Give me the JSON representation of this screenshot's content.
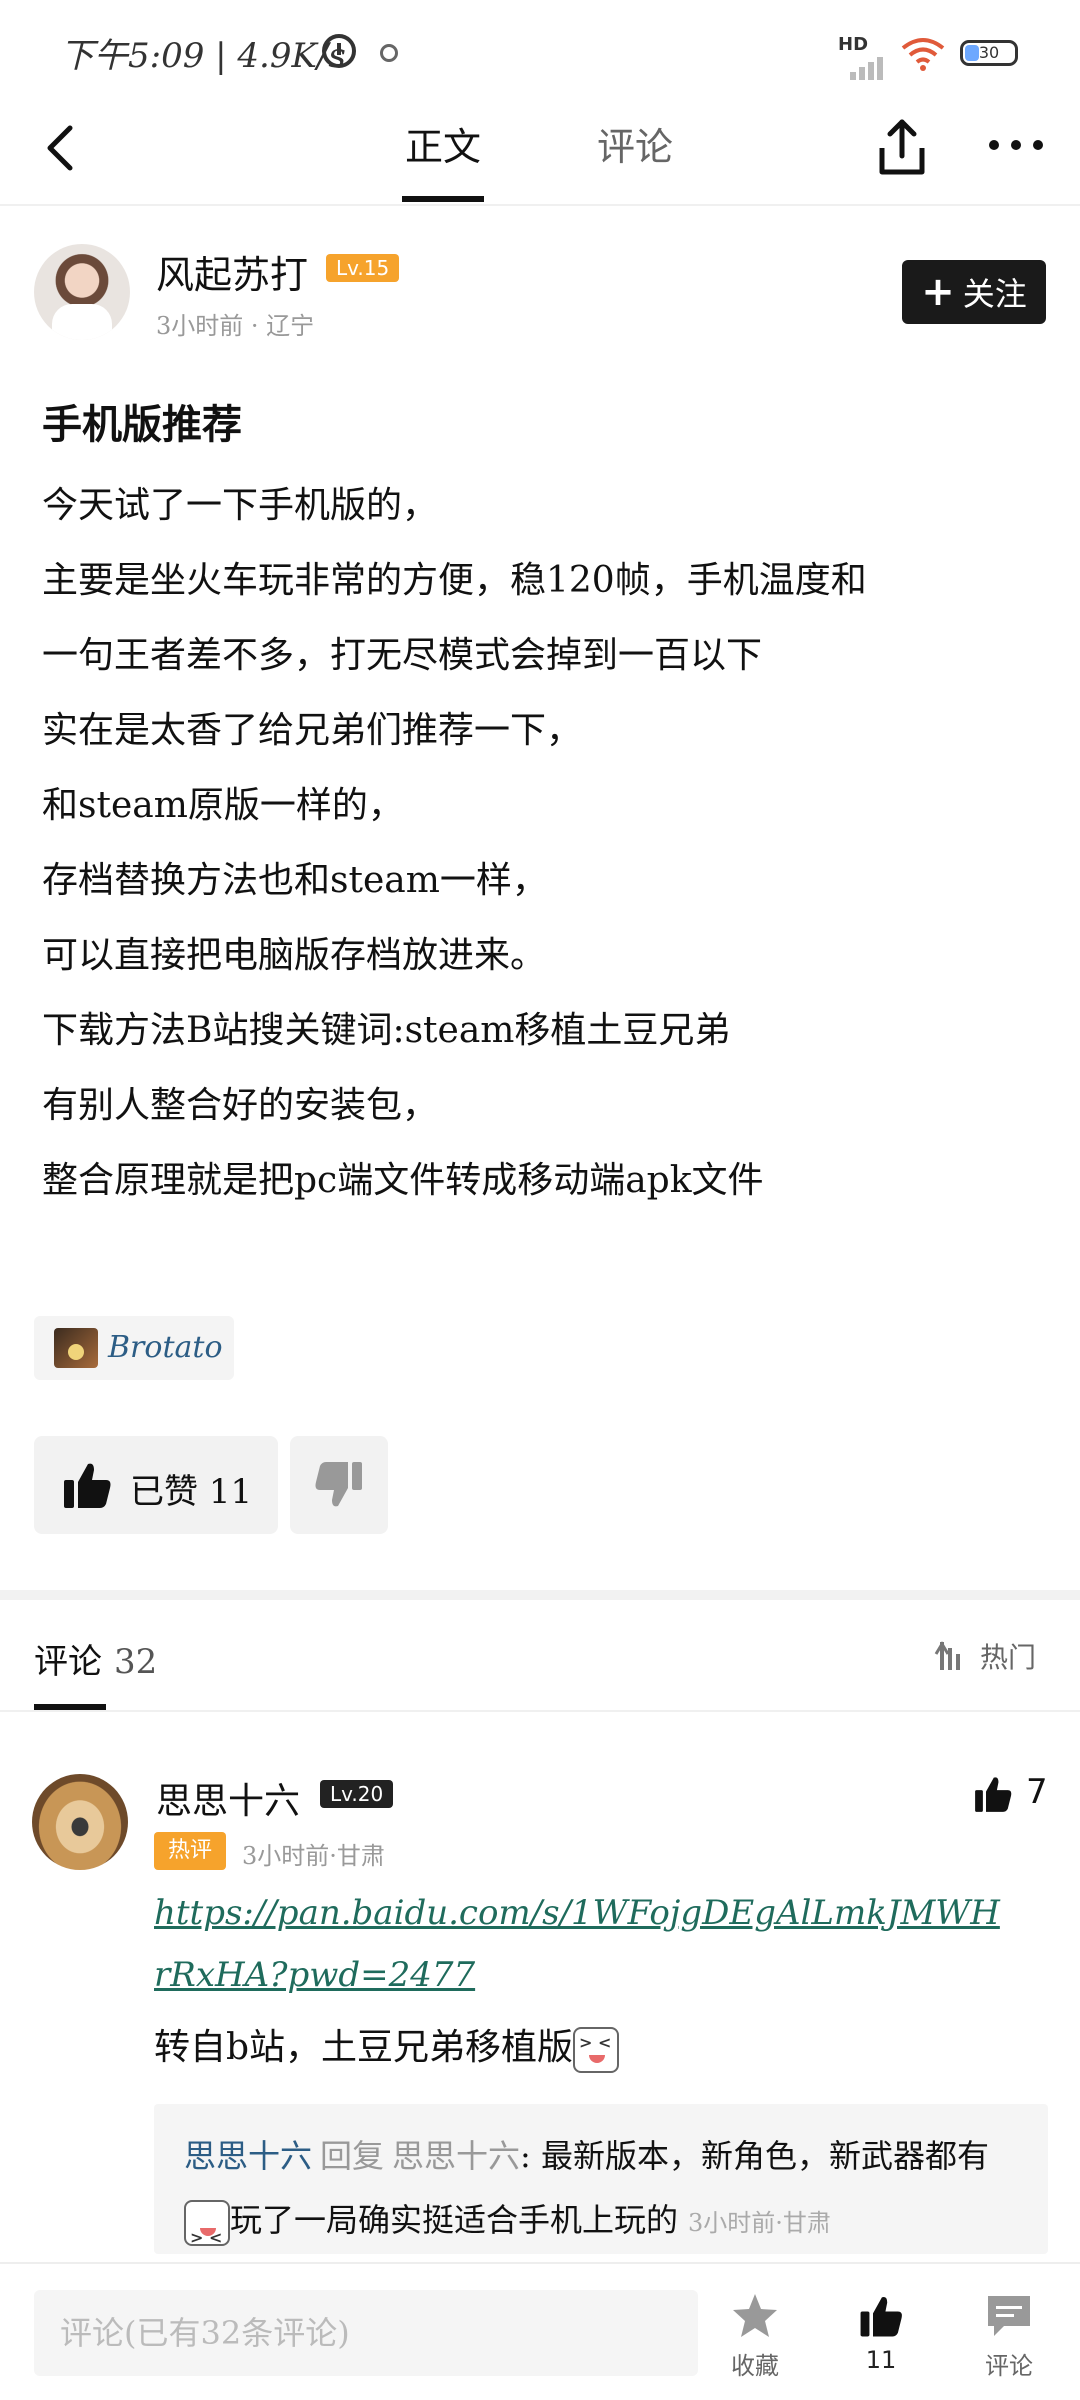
{
  "status_bar": {
    "time": "下午5:09 | 4.9K/s",
    "network_label": "HD",
    "battery": "30"
  },
  "nav": {
    "tab_main": "正文",
    "tab_comments": "评论"
  },
  "author": {
    "name": "风起苏打",
    "level": "Lv.15",
    "meta": "3小时前 · 辽宁",
    "follow_label": "关注"
  },
  "post": {
    "title": "手机版推荐",
    "lines": [
      "今天试了一下手机版的，",
      "主要是坐火车玩非常的方便，稳120帧，手机温度和",
      "一句王者差不多，打无尽模式会掉到一百以下",
      "实在是太香了给兄弟们推荐一下，",
      "和steam原版一样的，",
      "存档替换方法也和steam一样，",
      "可以直接把电脑版存档放进来。",
      "下载方法B站搜关键词:steam移植土豆兄弟",
      "有别人整合好的安装包，",
      "整合原理就是把pc端文件转成移动端apk文件"
    ],
    "tag": "Brotato",
    "like_label": "已赞",
    "like_count": "11"
  },
  "comments_section": {
    "title": "评论",
    "count": "32",
    "sort_label": "热门"
  },
  "comment": {
    "name": "思思十六",
    "level": "Lv.20",
    "likes": "7",
    "hot_badge": "热评",
    "meta": "3小时前·甘肃",
    "link": "https://pan.baidu.com/s/1WFojgDEgAlLmkJMWHrRxHA?pwd=2477",
    "text": "转自b站，土豆兄弟移植版"
  },
  "reply": {
    "name": "思思十六",
    "reply_word": "回复",
    "target": "思思十六",
    "text_part1": ": 最新版本，新角色，新武器都有",
    "text_part2": "玩了一局确实挺适合手机上玩的",
    "meta": "3小时前·甘肃"
  },
  "bottom_bar": {
    "input_placeholder": "评论(已有32条评论)",
    "favorite_label": "收藏",
    "like_count": "11",
    "comment_label": "评论"
  }
}
